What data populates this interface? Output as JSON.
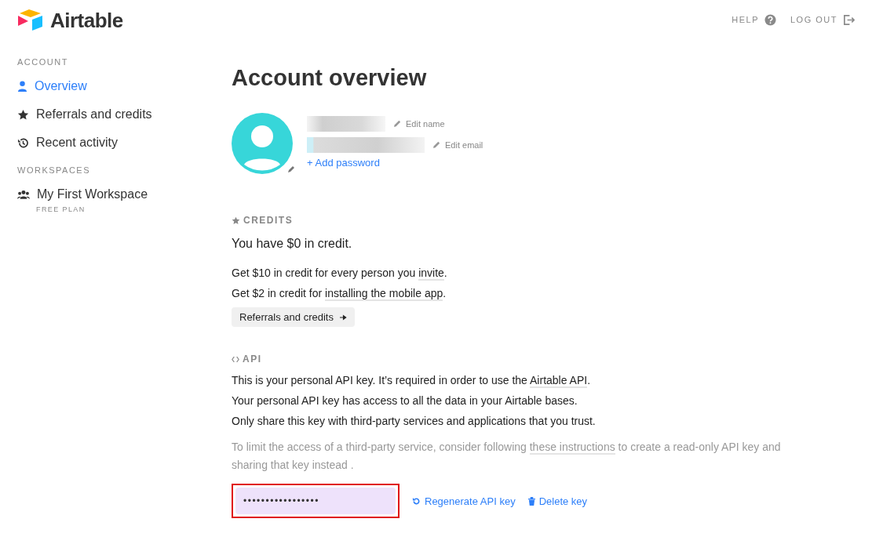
{
  "brand": {
    "name": "Airtable"
  },
  "header_links": [
    {
      "label": "HELP",
      "kind": "help"
    },
    {
      "label": "LOG OUT",
      "kind": "logout"
    }
  ],
  "sidebar": {
    "sections": [
      {
        "title": "ACCOUNT",
        "items": [
          {
            "label": "Overview",
            "kind": "person",
            "selected": true
          },
          {
            "label": "Referrals and credits",
            "kind": "star",
            "selected": false
          },
          {
            "label": "Recent activity",
            "kind": "history",
            "selected": false
          }
        ]
      },
      {
        "title": "WORKSPACES",
        "items": [
          {
            "label": "My First Workspace",
            "kind": "group",
            "selected": false,
            "sublabel": "FREE PLAN"
          }
        ]
      }
    ]
  },
  "page_title": "Account overview",
  "profile": {
    "edit_name": "Edit name",
    "edit_email": "Edit email",
    "add_password": "+ Add password"
  },
  "credits": {
    "heading": "CREDITS",
    "balance": "You have $0 in credit.",
    "lines": [
      [
        {
          "kind": "text",
          "text": "Get $10 in credit for every person you "
        },
        {
          "kind": "link",
          "text": "invite"
        },
        {
          "kind": "text",
          "text": "."
        }
      ],
      [
        {
          "kind": "text",
          "text": "Get $2 in credit for "
        },
        {
          "kind": "link",
          "text": "installing the mobile app"
        },
        {
          "kind": "text",
          "text": "."
        }
      ]
    ],
    "button": "Referrals and credits"
  },
  "api": {
    "heading": "API",
    "lines": [
      [
        {
          "kind": "text",
          "text": "This is your personal API key. It’s required in order to use the "
        },
        {
          "kind": "link",
          "text": "Airtable API"
        },
        {
          "kind": "text",
          "text": "."
        }
      ],
      [
        {
          "kind": "text",
          "text": "Your personal API key has access to all the data in your Airtable bases."
        }
      ],
      [
        {
          "kind": "text",
          "text": "Only share this key with third-party services and applications that you trust."
        }
      ]
    ],
    "note": [
      {
        "kind": "text",
        "text": "To limit the access of a third-party service, consider following "
      },
      {
        "kind": "link",
        "text": "these instructions"
      },
      {
        "kind": "text",
        "text": " to create a read-only API key and sharing that key instead ."
      }
    ],
    "key_value": "•••••••••••••••••",
    "key_highlighted": true,
    "actions": [
      {
        "label": "Regenerate API key",
        "kind": "regenerate"
      },
      {
        "label": "Delete key",
        "kind": "trash"
      }
    ]
  }
}
